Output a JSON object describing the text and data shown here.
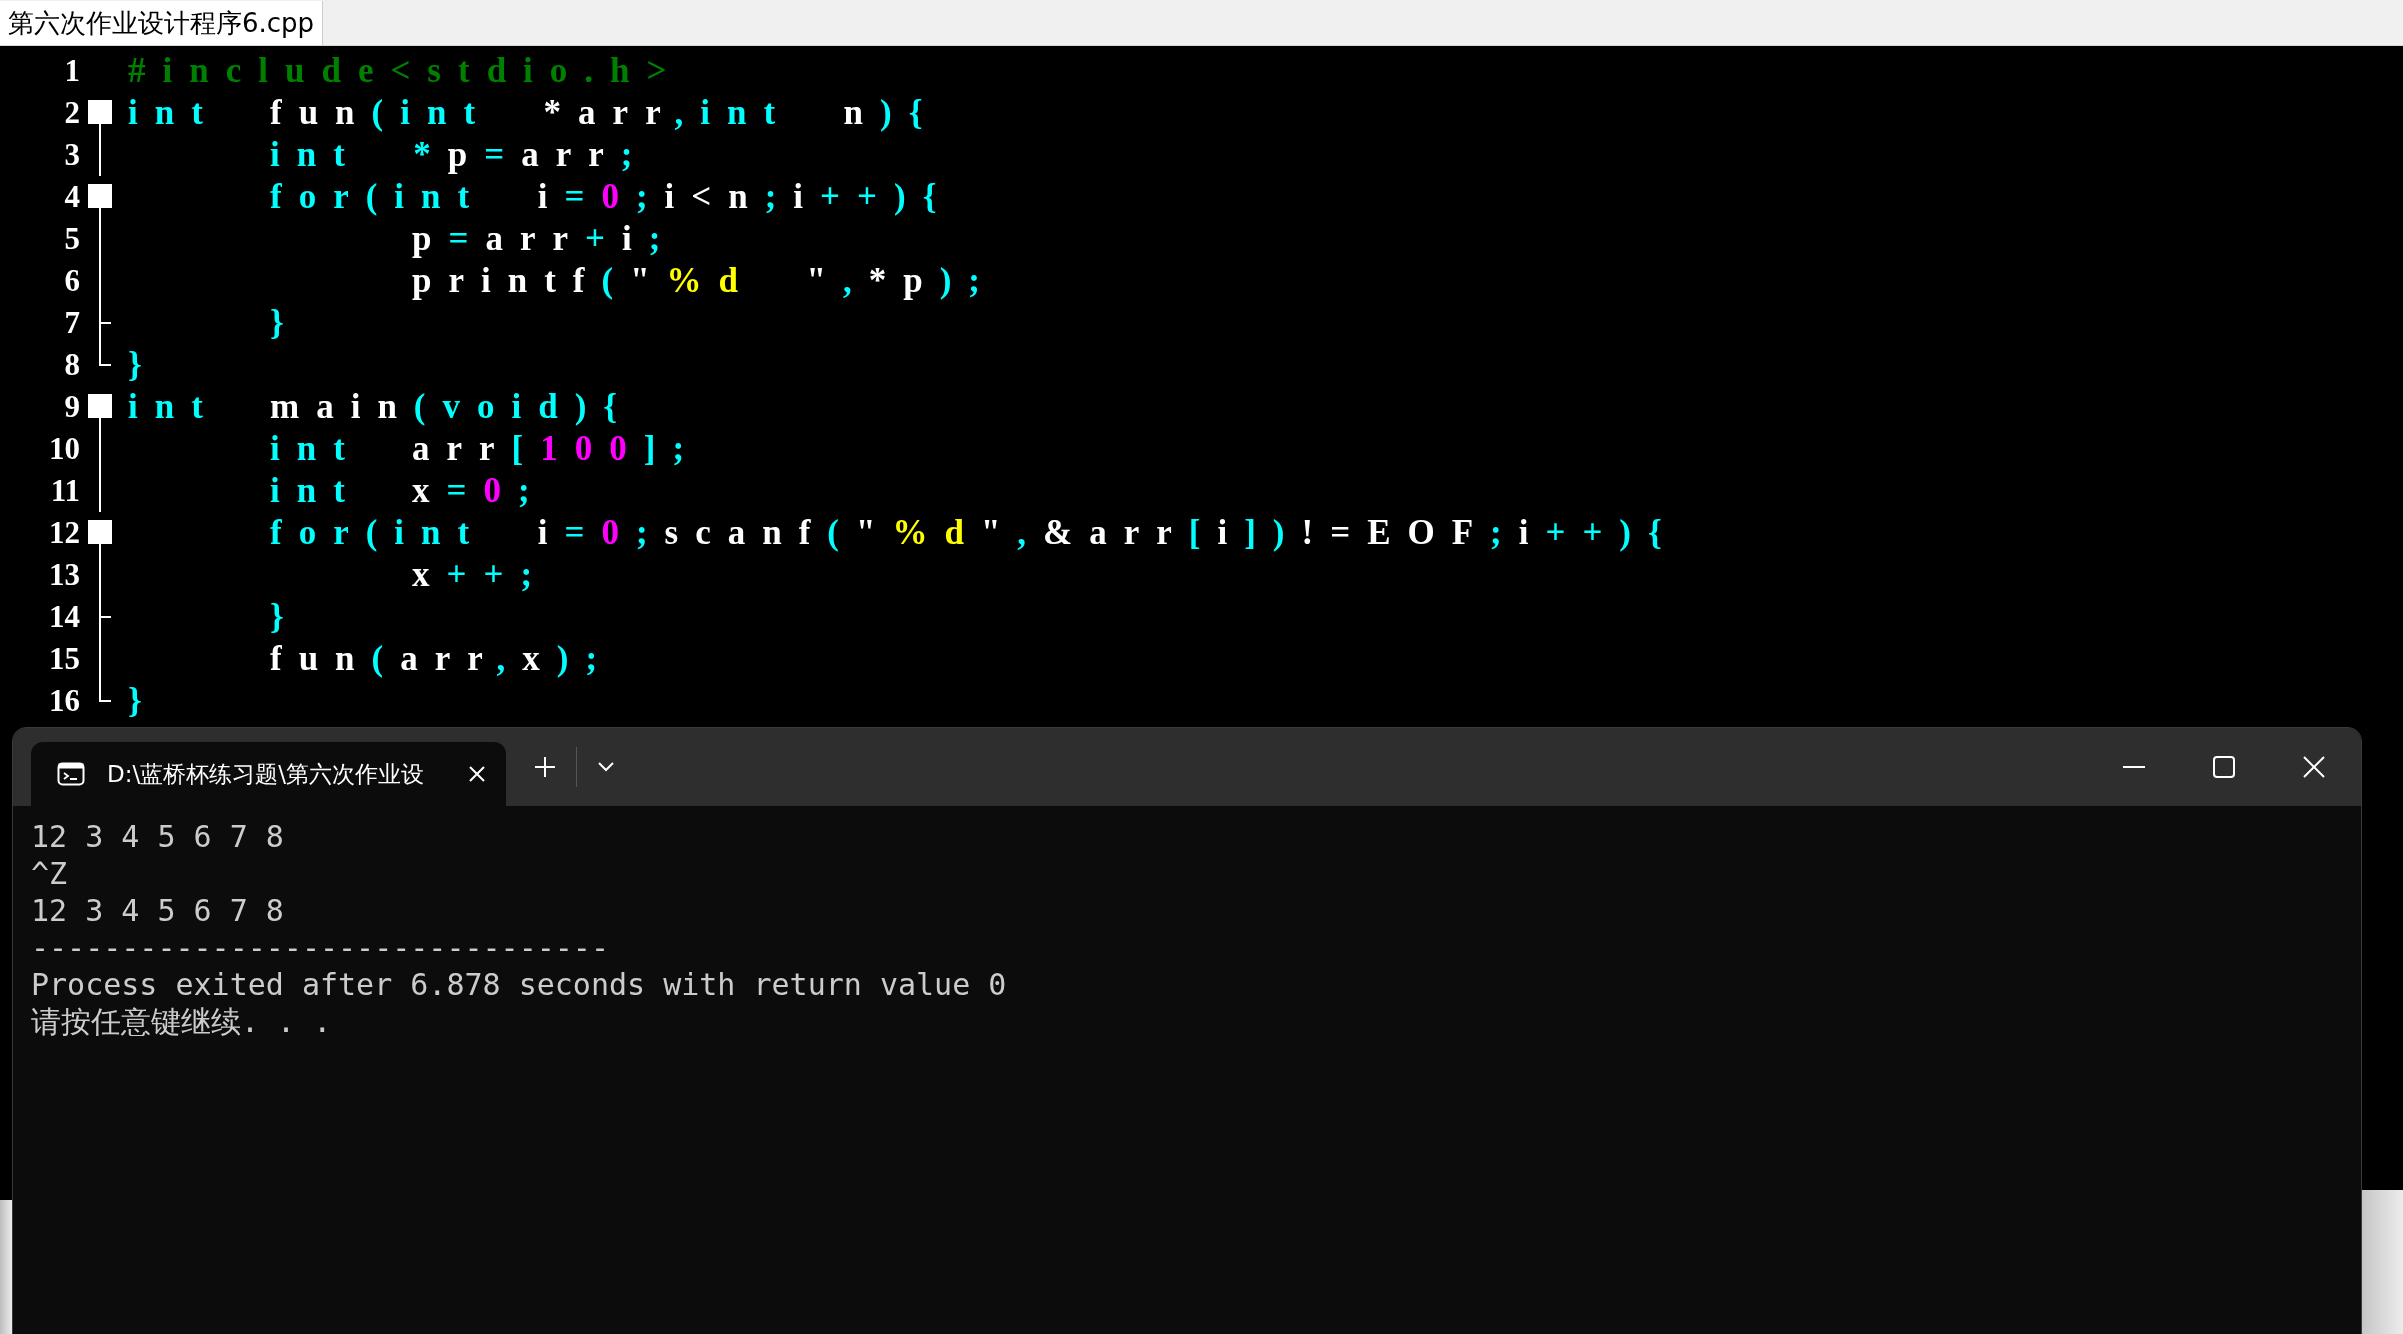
{
  "editor": {
    "tab": {
      "label": "第六次作业设计程序6.cpp",
      "selected": true
    },
    "lines": [
      {
        "number": "1",
        "tokens": [
          {
            "t": "#include<stdio.h>",
            "kind": "pre"
          }
        ]
      },
      {
        "number": "2",
        "kind": "open",
        "tokens": [
          {
            "t": "int\t",
            "kind": "kw"
          },
          {
            "t": "fun",
            "kind": "id"
          },
          {
            "t": "(",
            "kind": "p"
          },
          {
            "t": "int  ",
            "kind": "kw"
          },
          {
            "t": "*arr",
            "kind": "id"
          },
          {
            "t": ",",
            "kind": "p"
          },
          {
            "t": "int  ",
            "kind": "kw"
          },
          {
            "t": "n",
            "kind": "id"
          },
          {
            "t": "){",
            "kind": "p"
          }
        ]
      },
      {
        "number": "3",
        "kind": "line",
        "tokens": [
          {
            "t": "\tint  ",
            "kind": "kw"
          },
          {
            "t": "*",
            "kind": "p"
          },
          {
            "t": "p",
            "kind": "id"
          },
          {
            "t": "=",
            "kind": "p"
          },
          {
            "t": "arr",
            "kind": "id"
          },
          {
            "t": ";",
            "kind": "p"
          }
        ]
      },
      {
        "number": "4",
        "kind": "open",
        "tokens": [
          {
            "t": "\tfor",
            "kind": "kw"
          },
          {
            "t": "(",
            "kind": "p"
          },
          {
            "t": "int  ",
            "kind": "kw"
          },
          {
            "t": "i",
            "kind": "id"
          },
          {
            "t": "=",
            "kind": "p"
          },
          {
            "t": "0",
            "kind": "num"
          },
          {
            "t": ";",
            "kind": "p"
          },
          {
            "t": "i<n",
            "kind": "id"
          },
          {
            "t": ";",
            "kind": "p"
          },
          {
            "t": "i",
            "kind": "id"
          },
          {
            "t": "++){",
            "kind": "p"
          }
        ]
      },
      {
        "number": "5",
        "kind": "line",
        "tokens": [
          {
            "t": "\t\tp",
            "kind": "id"
          },
          {
            "t": "=",
            "kind": "p"
          },
          {
            "t": "arr",
            "kind": "id"
          },
          {
            "t": "+",
            "kind": "p"
          },
          {
            "t": "i",
            "kind": "id"
          },
          {
            "t": ";",
            "kind": "p"
          }
        ]
      },
      {
        "number": "6",
        "kind": "line",
        "tokens": [
          {
            "t": "\t\tprintf",
            "kind": "id"
          },
          {
            "t": "(",
            "kind": "p"
          },
          {
            "t": "\"",
            "kind": "id"
          },
          {
            "t": "%d  ",
            "kind": "str"
          },
          {
            "t": "\"",
            "kind": "id"
          },
          {
            "t": ",",
            "kind": "p"
          },
          {
            "t": "*p",
            "kind": "id"
          },
          {
            "t": ");",
            "kind": "p"
          }
        ]
      },
      {
        "number": "7",
        "kind": "tee",
        "tokens": [
          {
            "t": "\t}",
            "kind": "p"
          }
        ]
      },
      {
        "number": "8",
        "kind": "end",
        "tokens": [
          {
            "t": "}",
            "kind": "p"
          }
        ]
      },
      {
        "number": "9",
        "kind": "open",
        "tokens": [
          {
            "t": "int\t",
            "kind": "kw"
          },
          {
            "t": "main",
            "kind": "id"
          },
          {
            "t": "(",
            "kind": "p"
          },
          {
            "t": "void",
            "kind": "kw"
          },
          {
            "t": "){",
            "kind": "p"
          }
        ]
      },
      {
        "number": "10",
        "kind": "line",
        "tokens": [
          {
            "t": "\tint\t",
            "kind": "kw"
          },
          {
            "t": "arr",
            "kind": "id"
          },
          {
            "t": "[",
            "kind": "p"
          },
          {
            "t": "100",
            "kind": "num"
          },
          {
            "t": "];",
            "kind": "p"
          }
        ]
      },
      {
        "number": "11",
        "kind": "line",
        "tokens": [
          {
            "t": "\tint\t",
            "kind": "kw"
          },
          {
            "t": "x",
            "kind": "id"
          },
          {
            "t": "=",
            "kind": "p"
          },
          {
            "t": "0",
            "kind": "num"
          },
          {
            "t": ";",
            "kind": "p"
          }
        ]
      },
      {
        "number": "12",
        "kind": "open",
        "tokens": [
          {
            "t": "\tfor",
            "kind": "kw"
          },
          {
            "t": "(",
            "kind": "p"
          },
          {
            "t": "int  ",
            "kind": "kw"
          },
          {
            "t": "i",
            "kind": "id"
          },
          {
            "t": "=",
            "kind": "p"
          },
          {
            "t": "0",
            "kind": "num"
          },
          {
            "t": ";",
            "kind": "p"
          },
          {
            "t": "scanf",
            "kind": "id"
          },
          {
            "t": "(",
            "kind": "p"
          },
          {
            "t": "\"",
            "kind": "id"
          },
          {
            "t": "%d",
            "kind": "str"
          },
          {
            "t": "\"",
            "kind": "id"
          },
          {
            "t": ",",
            "kind": "p"
          },
          {
            "t": "&arr",
            "kind": "id"
          },
          {
            "t": "[",
            "kind": "p"
          },
          {
            "t": "i",
            "kind": "id"
          },
          {
            "t": "])",
            "kind": "p"
          },
          {
            "t": "!=EOF",
            "kind": "id"
          },
          {
            "t": ";",
            "kind": "p"
          },
          {
            "t": "i",
            "kind": "id"
          },
          {
            "t": "++){",
            "kind": "p"
          }
        ]
      },
      {
        "number": "13",
        "kind": "line",
        "tokens": [
          {
            "t": "\t\tx",
            "kind": "id"
          },
          {
            "t": "++;",
            "kind": "p"
          }
        ]
      },
      {
        "number": "14",
        "kind": "tee",
        "tokens": [
          {
            "t": "\t}",
            "kind": "p"
          }
        ]
      },
      {
        "number": "15",
        "kind": "line",
        "tokens": [
          {
            "t": "\tfun",
            "kind": "id"
          },
          {
            "t": "(",
            "kind": "p"
          },
          {
            "t": "arr",
            "kind": "id"
          },
          {
            "t": ",",
            "kind": "p"
          },
          {
            "t": "x",
            "kind": "id"
          },
          {
            "t": ");",
            "kind": "p"
          }
        ]
      },
      {
        "number": "16",
        "kind": "end",
        "tokens": [
          {
            "t": "}",
            "kind": "p"
          }
        ]
      }
    ]
  },
  "terminal": {
    "tab": {
      "title": "D:\\蓝桥杯练习题\\第六次作业设",
      "selected": true
    },
    "output": [
      "12 3 4 5 6 7 8",
      "^Z",
      "12 3 4 5 6 7 8",
      "--------------------------------",
      "Process exited after 6.878 seconds with return value 0",
      "请按任意键继续. . ."
    ]
  }
}
